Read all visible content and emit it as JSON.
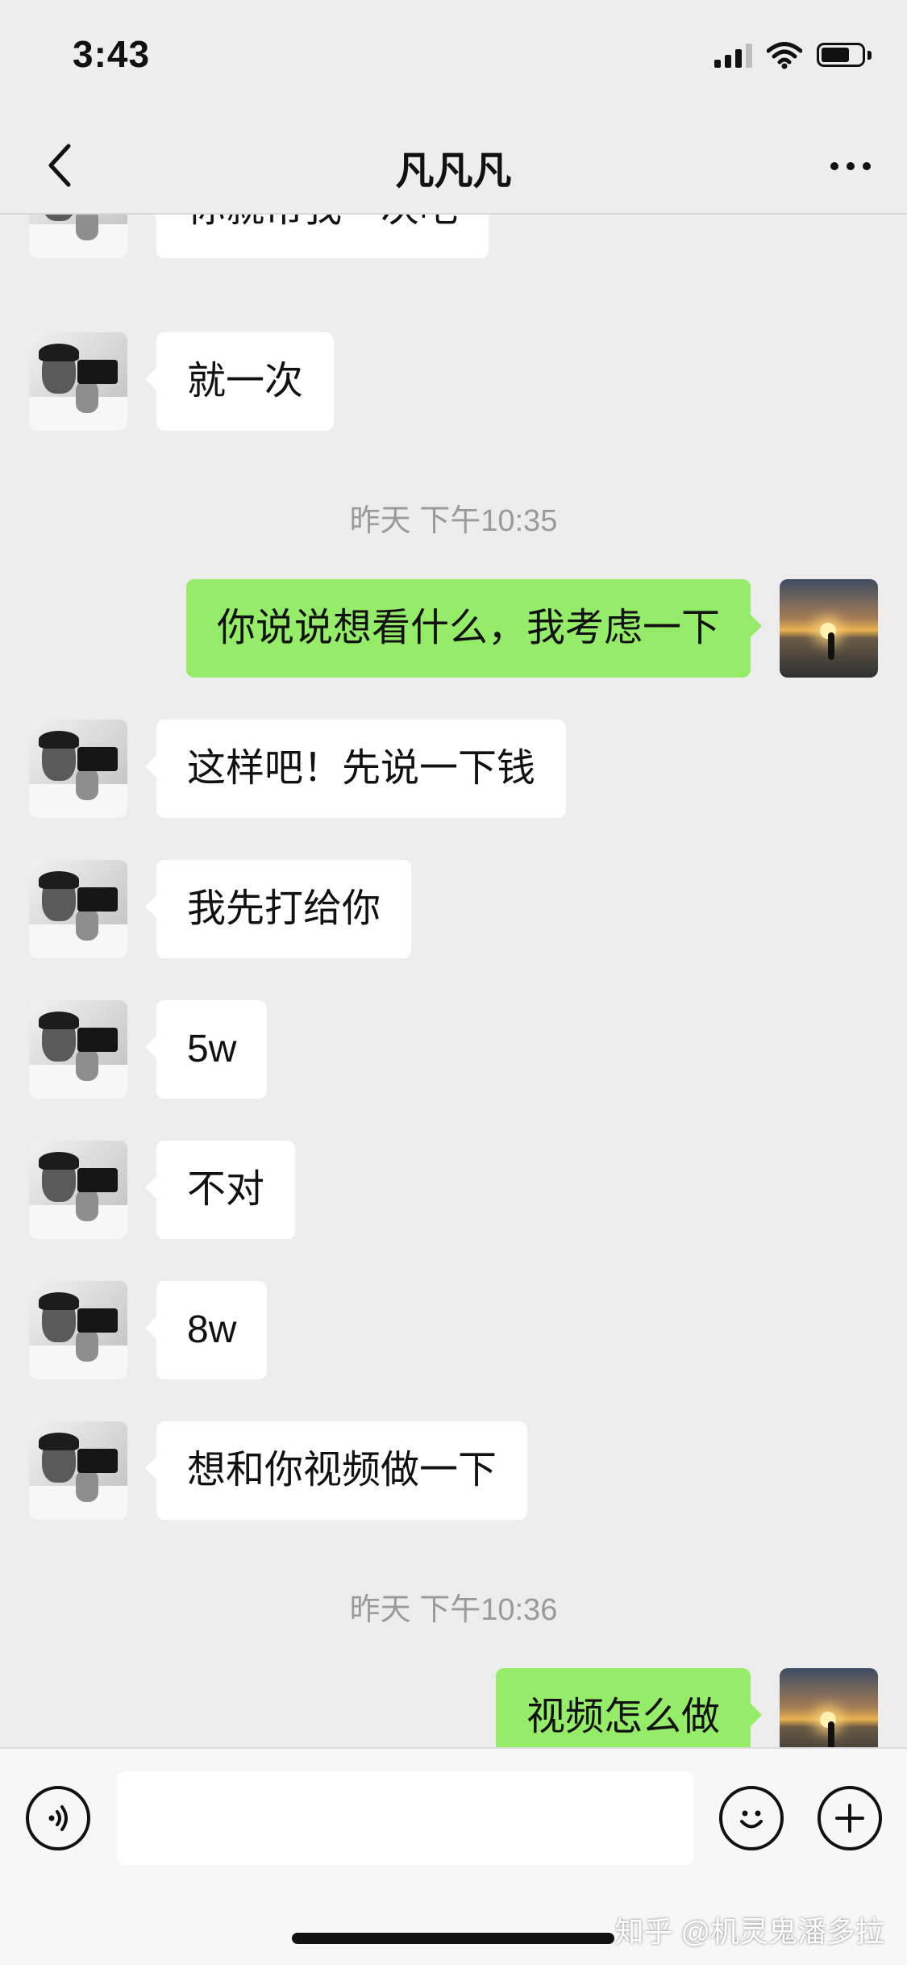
{
  "status_bar": {
    "time": "3:43"
  },
  "nav": {
    "title": "凡凡凡"
  },
  "messages": [
    {
      "direction": "in",
      "text": "你就帮我一次吧"
    },
    {
      "direction": "in",
      "text": "就一次"
    },
    {
      "type": "timestamp",
      "text": "昨天 下午10:35"
    },
    {
      "direction": "out",
      "text": "你说说想看什么，我考虑一下"
    },
    {
      "direction": "in",
      "text": "这样吧！先说一下钱"
    },
    {
      "direction": "in",
      "text": "我先打给你"
    },
    {
      "direction": "in",
      "text": "5w"
    },
    {
      "direction": "in",
      "text": "不对"
    },
    {
      "direction": "in",
      "text": "8w"
    },
    {
      "direction": "in",
      "text": "想和你视频做一下"
    },
    {
      "type": "timestamp",
      "text": "昨天 下午10:36"
    },
    {
      "direction": "out",
      "text": "视频怎么做"
    }
  ],
  "input": {
    "value": ""
  },
  "watermark": "知乎 @机灵鬼潘多拉",
  "colors": {
    "background": "#ededed",
    "outgoing_bubble": "#95ec69",
    "incoming_bubble": "#ffffff",
    "timestamp_text": "#9a9a9a"
  },
  "icons": {
    "back": "chevron-left-icon",
    "more": "more-dots-icon",
    "voice": "voice-icon",
    "emoji": "emoji-icon",
    "plus": "plus-icon"
  }
}
